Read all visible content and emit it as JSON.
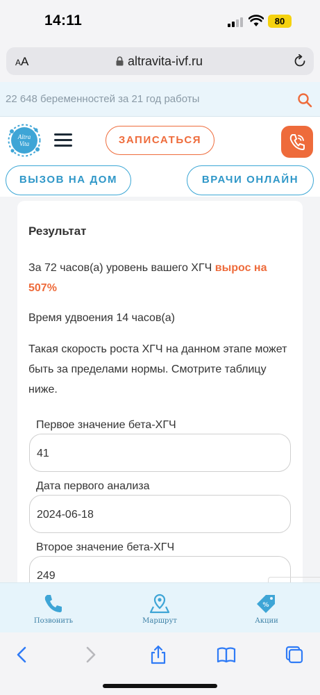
{
  "status_bar": {
    "time": "14:11",
    "battery": "80"
  },
  "browser": {
    "text_size_small": "A",
    "text_size_large": "A",
    "url": "altravita-ivf.ru"
  },
  "info_strip": {
    "text": "22 648 беременностей за 21 год работы"
  },
  "header": {
    "logo_text_top": "Altra",
    "logo_text_bottom": "Vita",
    "signup_button": "ЗАПИСАТЬСЯ",
    "home_visit_button": "ВЫЗОВ НА ДОМ",
    "doctors_online_button": "ВРАЧИ ОНЛАЙН"
  },
  "result": {
    "title": "Результат",
    "growth_text_before": "За 72 часов(а) уровень вашего ХГЧ ",
    "growth_value": "вырос на 507%",
    "doubling_time": "Время удвоения 14 часов(а)",
    "warning": "Такая скорость роста ХГЧ на данном этапе может быть за пределами нормы. Смотрите таблицу ниже."
  },
  "form": {
    "first_value_label": "Первое значение бета-ХГЧ",
    "first_value": "41",
    "first_date_label": "Дата первого анализа",
    "first_date": "2024-06-18",
    "second_value_label": "Второе значение бета-ХГЧ",
    "second_value": "249"
  },
  "bottom_nav": {
    "call": "Позвонить",
    "route": "Маршрут",
    "promotions": "Акции"
  },
  "colors": {
    "accent": "#ee6b3b",
    "primary": "#3aa6d5"
  }
}
